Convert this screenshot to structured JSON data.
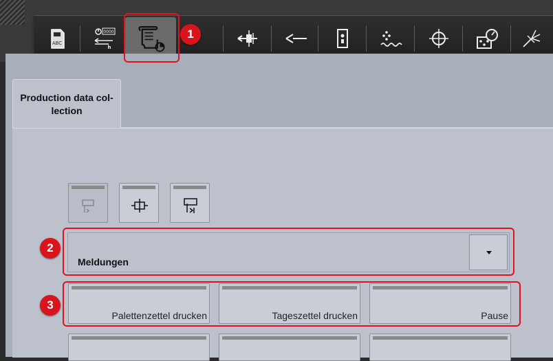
{
  "toolbar": {
    "items": [
      {
        "icon": "sd-card-icon",
        "card_text": "ABC"
      },
      {
        "icon": "counter-transfer-icon",
        "counter_text": "0000",
        "unit_text": "h"
      },
      {
        "icon": "production-log-icon",
        "active": true
      },
      {
        "icon": "move-ejector-icon"
      },
      {
        "icon": "injection-nozzle-icon"
      },
      {
        "icon": "mold-open-icon"
      },
      {
        "icon": "heating-icon"
      },
      {
        "icon": "target-crosshair-icon"
      },
      {
        "icon": "dashboard-gauge-icon"
      },
      {
        "icon": "light-beam-icon"
      }
    ]
  },
  "tab": {
    "label_line1": "Production data col-",
    "label_line2": "lection"
  },
  "small_buttons": [
    {
      "icon": "step-in-icon",
      "enabled": false
    },
    {
      "icon": "center-position-icon",
      "enabled": true
    },
    {
      "icon": "step-end-icon",
      "enabled": true
    }
  ],
  "dropdown": {
    "value": "Meldungen"
  },
  "actions": [
    {
      "label": "Palettenzettel drucken"
    },
    {
      "label": "Tageszettel drucken"
    },
    {
      "label": "Pause"
    }
  ],
  "annotations": [
    {
      "number": "1"
    },
    {
      "number": "2"
    },
    {
      "number": "3"
    }
  ],
  "colors": {
    "highlight": "#e0141e",
    "badge": "#d8141c",
    "panel": "#bcc1cc",
    "toolbar": "#2a2a2a"
  }
}
